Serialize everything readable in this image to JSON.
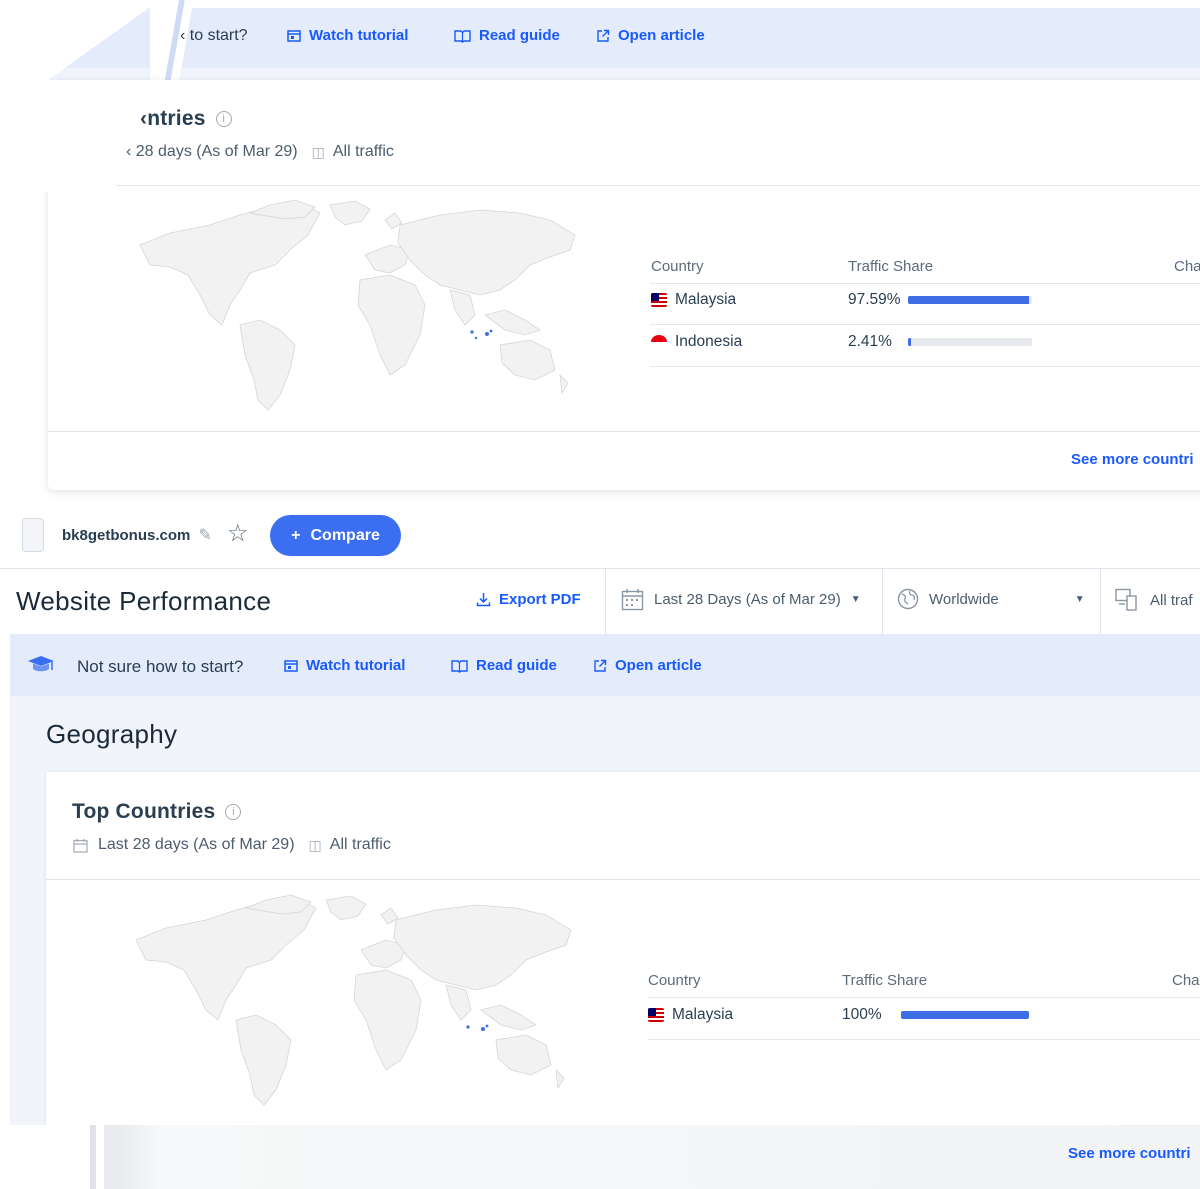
{
  "top_section": {
    "banner": {
      "prompt_fragment": "‹ to start?",
      "links": [
        {
          "label": "Watch tutorial",
          "icon": "video-icon"
        },
        {
          "label": "Read guide",
          "icon": "book-icon"
        },
        {
          "label": "Open article",
          "icon": "external-link-icon"
        }
      ]
    },
    "card": {
      "title_fragment": "‹ntries",
      "date_fragment": "‹ 28 days (As of Mar 29)",
      "traffic_label": "All traffic",
      "table": {
        "headers": [
          "Country",
          "Traffic Share",
          "Cha"
        ],
        "rows": [
          {
            "country": "Malaysia",
            "flag": "malaysia-flag",
            "share": "97.59%",
            "share_value": 0.9759
          },
          {
            "country": "Indonesia",
            "flag": "indonesia-flag",
            "share": "2.41%",
            "share_value": 0.0241
          }
        ]
      },
      "see_more": "See more countri"
    }
  },
  "domain_bar": {
    "domain": "bk8getbonus.com",
    "compare_label": "Compare",
    "compare_icon": "+"
  },
  "header": {
    "title": "Website Performance",
    "export_label": "Export PDF",
    "date_filter": "Last 28 Days (As of Mar 29)",
    "region_filter": "Worldwide",
    "traffic_filter": "All traf"
  },
  "lower_banner": {
    "prompt": "Not sure how to start?",
    "links": [
      {
        "label": "Watch tutorial",
        "icon": "video-icon"
      },
      {
        "label": "Read guide",
        "icon": "book-icon"
      },
      {
        "label": "Open article",
        "icon": "external-link-icon"
      }
    ]
  },
  "geography": {
    "section_title": "Geography",
    "card": {
      "title": "Top Countries",
      "date_range": "Last 28 days (As of Mar 29)",
      "traffic_label": "All traffic",
      "table": {
        "headers": [
          "Country",
          "Traffic Share",
          "Cha"
        ],
        "rows": [
          {
            "country": "Malaysia",
            "flag": "malaysia-flag",
            "share": "100%",
            "share_value": 1.0
          }
        ]
      },
      "see_more": "See more countri"
    }
  },
  "colors": {
    "accent": "#195afe",
    "button": "#3b6ef0",
    "banner_bg": "#e4ebfb",
    "bar_fill": "#3e6ee6"
  }
}
